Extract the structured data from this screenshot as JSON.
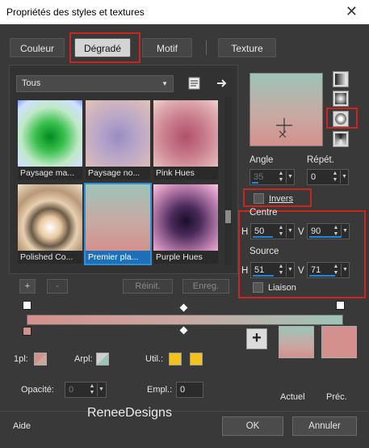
{
  "window": {
    "title": "Propriétés des styles et textures"
  },
  "tabs": [
    {
      "label": "Couleur"
    },
    {
      "label": "Dégradé"
    },
    {
      "label": "Motif"
    },
    {
      "label": "Texture"
    }
  ],
  "library": {
    "category_select": "Tous",
    "gradients": [
      {
        "label": "Paysage ma..."
      },
      {
        "label": "Paysage no..."
      },
      {
        "label": "Pink Hues"
      },
      {
        "label": "Polished Co..."
      },
      {
        "label": "Premier pla..."
      },
      {
        "label": "Purple Hues"
      }
    ],
    "add_label": "+",
    "remove_label": "-",
    "reset_label": "Réinit.",
    "save_label": "Enreg."
  },
  "gradient_settings": {
    "angle_label": "Angle",
    "angle_value": "35",
    "repeat_label": "Répét.",
    "repeat_value": "0",
    "invert_label": "Invers",
    "center_label": "Centre",
    "center_h_label": "H",
    "center_h_value": "50",
    "center_v_label": "V",
    "center_v_value": "90",
    "source_label": "Source",
    "source_h_label": "H",
    "source_h_value": "51",
    "source_v_label": "V",
    "source_v_value": "71",
    "link_label": "Liaison"
  },
  "editor": {
    "fg_label": "1pl:",
    "bg_label": "Arpl:",
    "user_label": "Util.:",
    "opacity_label": "Opacité:",
    "opacity_value": "0",
    "location_label": "Empl.:",
    "location_value": "0"
  },
  "swatches": {
    "current_label": "Actuel",
    "previous_label": "Préc.",
    "add_label": "+"
  },
  "footer": {
    "help_label": "Aide",
    "ok_label": "OK",
    "cancel_label": "Annuler"
  },
  "watermark": "ReneeDesigns",
  "colors": {
    "gradient_start": "#d4908c",
    "gradient_end": "#9ec4b8",
    "user_color": "#f2c31c",
    "highlight_red": "#c8261e",
    "selection_blue": "#1d6fb8"
  }
}
